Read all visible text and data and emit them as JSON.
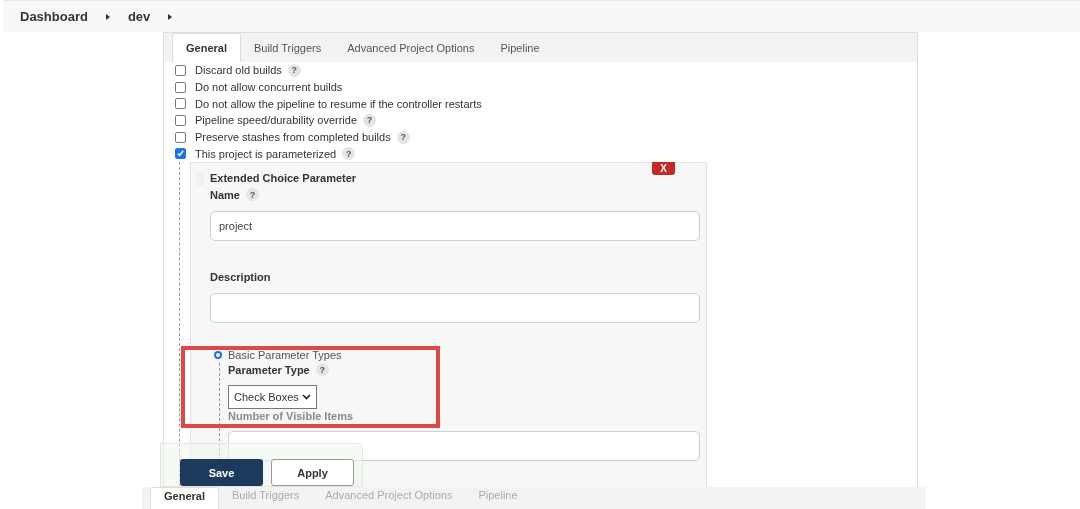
{
  "breadcrumbs": [
    {
      "label": "Dashboard"
    },
    {
      "label": "dev"
    }
  ],
  "tabs": [
    {
      "label": "General",
      "selected": true
    },
    {
      "label": "Build Triggers",
      "selected": false
    },
    {
      "label": "Advanced Project Options",
      "selected": false
    },
    {
      "label": "Pipeline",
      "selected": false
    }
  ],
  "options": [
    {
      "label": "Discard old builds",
      "checked": false,
      "help": "?"
    },
    {
      "label": "Do not allow concurrent builds",
      "checked": false
    },
    {
      "label": "Do not allow the pipeline to resume if the controller restarts",
      "checked": false
    },
    {
      "label": "Pipeline speed/durability override",
      "checked": false,
      "help": "?"
    },
    {
      "label": "Preserve stashes from completed builds",
      "checked": false,
      "help": "?"
    },
    {
      "label": "This project is parameterized",
      "checked": true,
      "help": "?"
    }
  ],
  "parameter": {
    "title": "Extended Choice Parameter",
    "delete": "X",
    "name_label": "Name",
    "name_help": "?",
    "name_value": "project",
    "description_label": "Description",
    "radio": {
      "label": "Basic Parameter Types",
      "selected": true
    },
    "type_label": "Parameter Type",
    "type_help": "?",
    "type_value": "Check Boxes",
    "visible_items_label": "Number of Visible Items"
  },
  "actions": [
    {
      "label": "Save",
      "kind": "primary"
    },
    {
      "label": "Apply",
      "kind": "secondary"
    }
  ],
  "sticky_tabs": [
    {
      "label": "General",
      "selected": true
    },
    {
      "label": "Build Triggers",
      "selected": false
    },
    {
      "label": "Advanced Project Options",
      "selected": false
    },
    {
      "label": "Pipeline",
      "selected": false
    }
  ]
}
